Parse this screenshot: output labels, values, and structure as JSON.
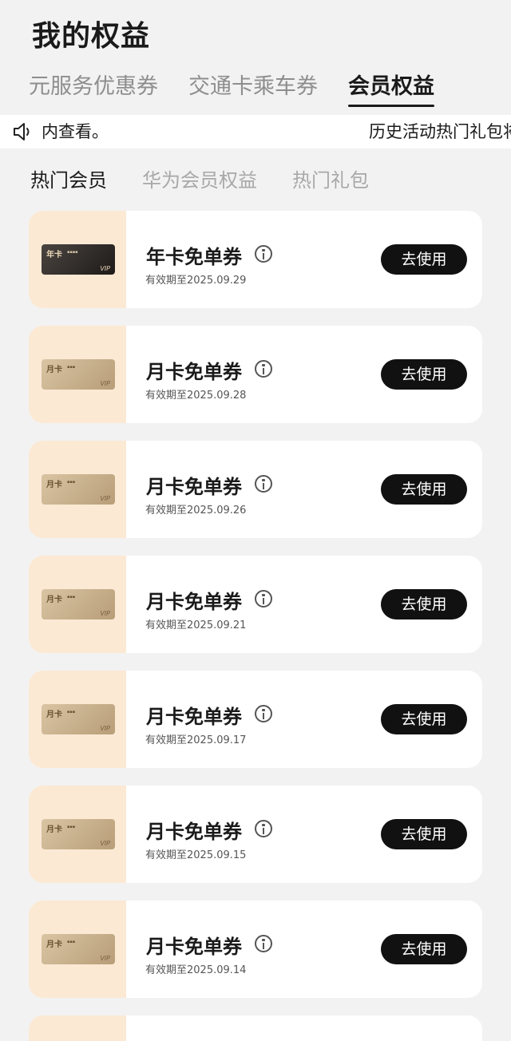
{
  "header": {
    "title": "我的权益"
  },
  "main_tabs": [
    {
      "label": "元服务优惠券",
      "active": false
    },
    {
      "label": "交通卡乘车券",
      "active": false
    },
    {
      "label": "会员权益",
      "active": true
    }
  ],
  "notice": {
    "icon": "speaker-icon",
    "text": "内查看。",
    "text_2": "历史活动热门礼包将"
  },
  "sub_tabs": [
    {
      "label": "热门会员",
      "active": true
    },
    {
      "label": "华为会员权益",
      "active": false
    },
    {
      "label": "热门礼包",
      "active": false
    }
  ],
  "card_art": {
    "annual": "年卡",
    "monthly": "月卡",
    "brand": "VIP"
  },
  "coupons": [
    {
      "title": "年卡免单券",
      "expiry": "有效期至2025.09.29",
      "button": "去使用",
      "style": "dark"
    },
    {
      "title": "月卡免单券",
      "expiry": "有效期至2025.09.28",
      "button": "去使用",
      "style": "gold"
    },
    {
      "title": "月卡免单券",
      "expiry": "有效期至2025.09.26",
      "button": "去使用",
      "style": "gold"
    },
    {
      "title": "月卡免单券",
      "expiry": "有效期至2025.09.21",
      "button": "去使用",
      "style": "gold"
    },
    {
      "title": "月卡免单券",
      "expiry": "有效期至2025.09.17",
      "button": "去使用",
      "style": "gold"
    },
    {
      "title": "月卡免单券",
      "expiry": "有效期至2025.09.15",
      "button": "去使用",
      "style": "gold"
    },
    {
      "title": "月卡免单券",
      "expiry": "有效期至2025.09.14",
      "button": "去使用",
      "style": "gold"
    }
  ],
  "colors": {
    "background": "#f2f2f2",
    "button": "#111111",
    "thumb_bg": "#fbe9d4"
  }
}
